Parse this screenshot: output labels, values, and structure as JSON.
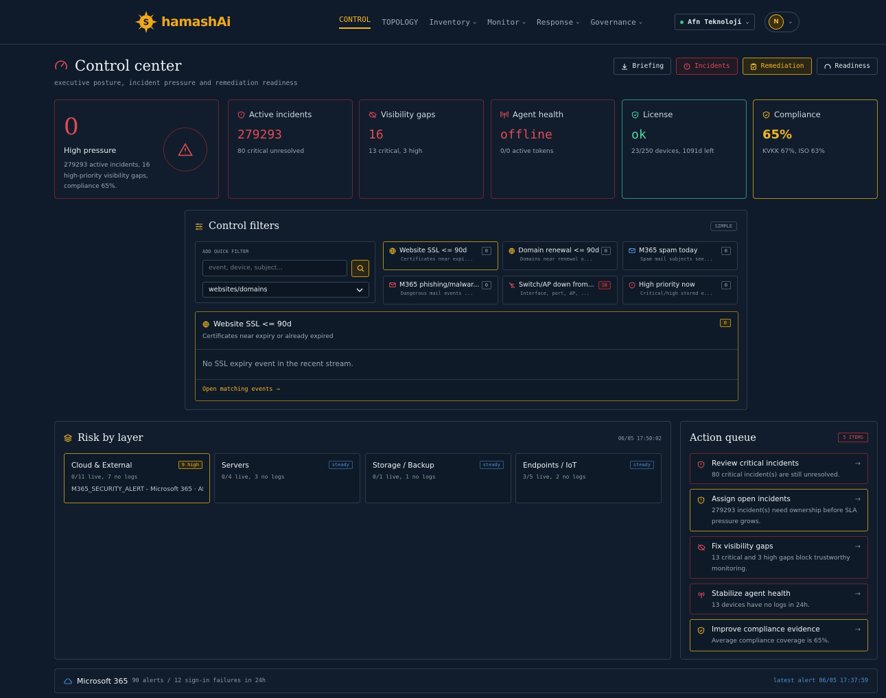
{
  "brand": {
    "name": "hamashAi"
  },
  "nav": {
    "items": [
      {
        "label": "CONTROL",
        "active": true,
        "dropdown": false
      },
      {
        "label": "TOPOLOGY",
        "active": false,
        "dropdown": false
      },
      {
        "label": "Inventory",
        "active": false,
        "dropdown": true
      },
      {
        "label": "Monitor",
        "active": false,
        "dropdown": true
      },
      {
        "label": "Response",
        "active": false,
        "dropdown": true
      },
      {
        "label": "Governance",
        "active": false,
        "dropdown": true
      }
    ],
    "org": "Afn Teknoloji",
    "avatar_initial": "N"
  },
  "header": {
    "title": "Control center",
    "subtitle": "executive posture, incident pressure and remediation readiness",
    "buttons": {
      "briefing": "Briefing",
      "incidents": "Incidents",
      "remediation": "Remediation",
      "readiness": "Readiness"
    }
  },
  "pressure": {
    "value": "0",
    "label": "High pressure",
    "description": "279293 active incidents, 16 high-priority visibility gaps, compliance 65%."
  },
  "kpis": {
    "incidents": {
      "title": "Active incidents",
      "value": "279293",
      "sub": "80 critical unresolved"
    },
    "gaps": {
      "title": "Visibility gaps",
      "value": "16",
      "sub": "13 critical, 3 high"
    },
    "agent": {
      "title": "Agent health",
      "value": "offline",
      "sub": "0/0 active tokens"
    },
    "license": {
      "title": "License",
      "value": "ok",
      "sub": "23/250 devices, 1091d left"
    },
    "compliance": {
      "title": "Compliance",
      "value": "65%",
      "sub": "KVKK 67%, ISO 63%"
    }
  },
  "filters": {
    "title": "Control filters",
    "mode": "SIMPLE",
    "quick_label": "ADD QUICK FILTER",
    "input_placeholder": "event, device, subject...",
    "select_value": "websites/domains",
    "chips": {
      "ssl": {
        "title": "Website SSL <= 90d",
        "sub": "Certificates near expi...",
        "count": "0"
      },
      "domain": {
        "title": "Domain renewal <= 90d",
        "sub": "Domains near renewal o...",
        "count": "0"
      },
      "spam": {
        "title": "M365 spam today",
        "sub": "Spam mail subjects see...",
        "count": "0"
      },
      "phish": {
        "title": "M365 phishing/malwar...",
        "sub": "Dangerous mail events ...",
        "count": "0"
      },
      "switch": {
        "title": "Switch/AP down from...",
        "sub": "Interface, port, AP, ...",
        "count": "18"
      },
      "priority": {
        "title": "High priority now",
        "sub": "Critical/high stored e...",
        "count": "0"
      }
    },
    "detail": {
      "title": "Website SSL <= 90d",
      "sub": "Certificates near expiry or already expired",
      "count": "0",
      "empty": "No SSL expiry event in the recent stream.",
      "link": "Open matching events"
    }
  },
  "risk": {
    "title": "Risk by layer",
    "timestamp": "06/05 17:50:02",
    "layers": {
      "cloud": {
        "title": "Cloud & External",
        "badge": "9 high",
        "sub": "0/11 live, 7 no logs",
        "extra": "M365_SECURITY_ALERT - Microsoft 365 · Af..."
      },
      "servers": {
        "title": "Servers",
        "badge": "steady",
        "sub": "0/4 live, 3 no logs"
      },
      "storage": {
        "title": "Storage / Backup",
        "badge": "steady",
        "sub": "0/1 live, 1 no logs"
      },
      "endpoints": {
        "title": "Endpoints / IoT",
        "badge": "steady",
        "sub": "3/5 live, 2 no logs"
      }
    }
  },
  "queue": {
    "title": "Action queue",
    "badge": "5 ITEMS",
    "items": {
      "review": {
        "title": "Review critical incidents",
        "desc": "80 critical incident(s) are still unresolved."
      },
      "assign": {
        "title": "Assign open incidents",
        "desc": "279293 incident(s) need ownership before SLA pressure grows."
      },
      "gaps": {
        "title": "Fix visibility gaps",
        "desc": "13 critical and 3 high gaps block trustworthy monitoring."
      },
      "agent": {
        "title": "Stabilize agent health",
        "desc": "13 devices have no logs in 24h."
      },
      "compliance": {
        "title": "Improve compliance evidence",
        "desc": "Average compliance coverage is 65%."
      }
    }
  },
  "m365": {
    "title": "Microsoft 365",
    "sub": "90 alerts / 12 sign-in failures in 24h",
    "latest": "latest alert 06/05 17:37:59"
  },
  "colors": {
    "background": "#0f1b2a",
    "accent": "#f0b429",
    "danger": "#e24b57",
    "success": "#4fd9a6",
    "info": "#4e8fd4"
  }
}
